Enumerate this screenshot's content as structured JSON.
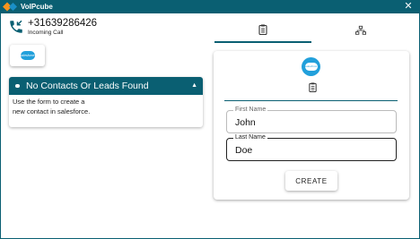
{
  "window": {
    "title": "VoIPcube",
    "close_label": "✕",
    "accent_color": "#0a5f72"
  },
  "call": {
    "number": "+31639286426",
    "status": "Incoming Call",
    "icon": "incoming-call-icon"
  },
  "salesforce_button": {
    "icon": "salesforce-icon",
    "logo_text": "salesforce"
  },
  "results": {
    "title": "No Contacts Or Leads Found",
    "message_line1": "Use the form to create a",
    "message_line2": "new contact in salesforce.",
    "caret": "▲"
  },
  "tabs": [
    {
      "icon": "clipboard-icon",
      "active": true
    },
    {
      "icon": "hierarchy-icon",
      "active": false
    }
  ],
  "form": {
    "logo_text": "salesforce",
    "fields": {
      "first_name": {
        "label": "First Name",
        "value": "John"
      },
      "last_name": {
        "label": "Last Name",
        "value": "Doe"
      }
    },
    "create_label": "CREATE"
  }
}
